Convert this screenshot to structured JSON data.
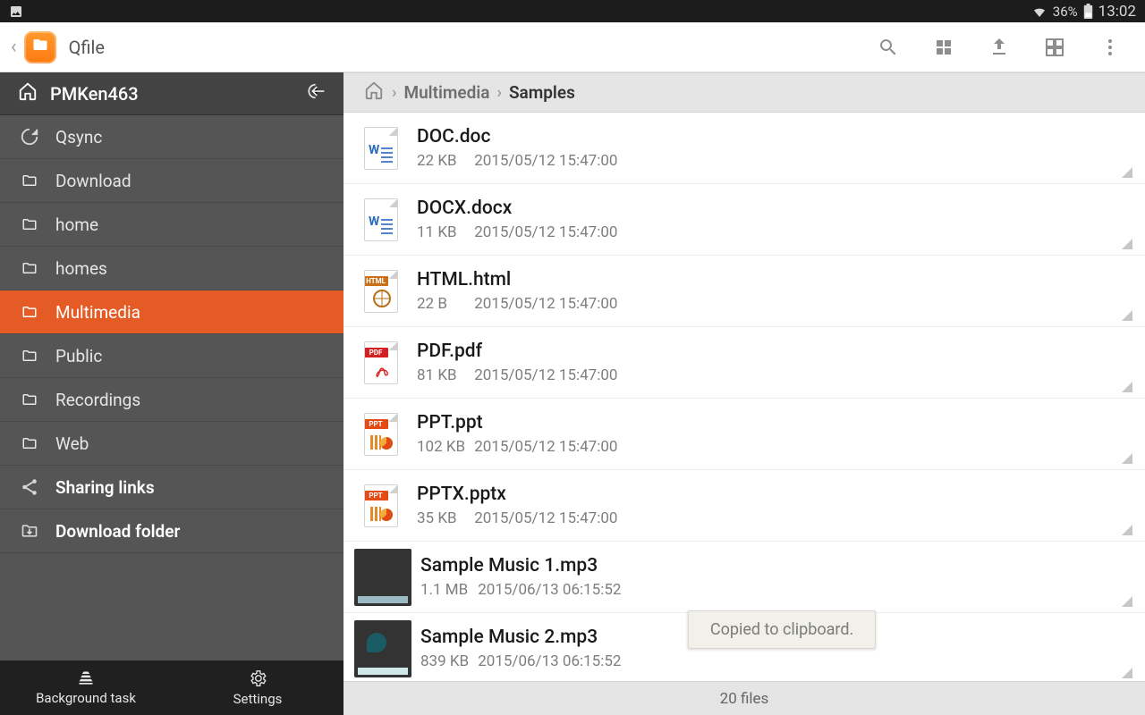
{
  "statusbar": {
    "battery": "36%",
    "clock": "13:02"
  },
  "app": {
    "title": "Qfile"
  },
  "sidebar": {
    "nas": "PMKen463",
    "items": [
      {
        "label": "Qsync",
        "icon": "sync"
      },
      {
        "label": "Download",
        "icon": "folder"
      },
      {
        "label": "home",
        "icon": "folder"
      },
      {
        "label": "homes",
        "icon": "folder"
      },
      {
        "label": "Multimedia",
        "icon": "folder",
        "selected": true
      },
      {
        "label": "Public",
        "icon": "folder"
      },
      {
        "label": "Recordings",
        "icon": "folder"
      },
      {
        "label": "Web",
        "icon": "folder"
      },
      {
        "label": "Sharing links",
        "icon": "share",
        "bold": true
      },
      {
        "label": "Download folder",
        "icon": "download-folder",
        "bold": true
      }
    ],
    "bottom": {
      "bg_task": "Background task",
      "settings": "Settings"
    }
  },
  "breadcrumb": {
    "lvl1": "Multimedia",
    "lvl2": "Samples"
  },
  "files": [
    {
      "name": "DOC.doc",
      "size": "22 KB",
      "date": "2015/05/12 15:47:00",
      "kind": "word"
    },
    {
      "name": "DOCX.docx",
      "size": "11 KB",
      "date": "2015/05/12 15:47:00",
      "kind": "word"
    },
    {
      "name": "HTML.html",
      "size": "22 B",
      "date": "2015/05/12 15:47:00",
      "kind": "html"
    },
    {
      "name": "PDF.pdf",
      "size": "81 KB",
      "date": "2015/05/12 15:47:00",
      "kind": "pdf"
    },
    {
      "name": "PPT.ppt",
      "size": "102 KB",
      "date": "2015/05/12 15:47:00",
      "kind": "ppt"
    },
    {
      "name": "PPTX.pptx",
      "size": "35 KB",
      "date": "2015/05/12 15:47:00",
      "kind": "ppt"
    },
    {
      "name": "Sample Music 1.mp3",
      "size": "1.1 MB",
      "date": "2015/06/13 06:15:52",
      "kind": "photo-sunset"
    },
    {
      "name": "Sample Music 2.mp3",
      "size": "839 KB",
      "date": "2015/06/13 06:15:52",
      "kind": "photo-sea"
    }
  ],
  "footer": {
    "count": "20 files"
  },
  "toast": {
    "text": "Copied to clipboard."
  },
  "icon_tags": {
    "word": "W",
    "html": "HTML",
    "pdf": "PDF",
    "ppt": "PPT"
  }
}
